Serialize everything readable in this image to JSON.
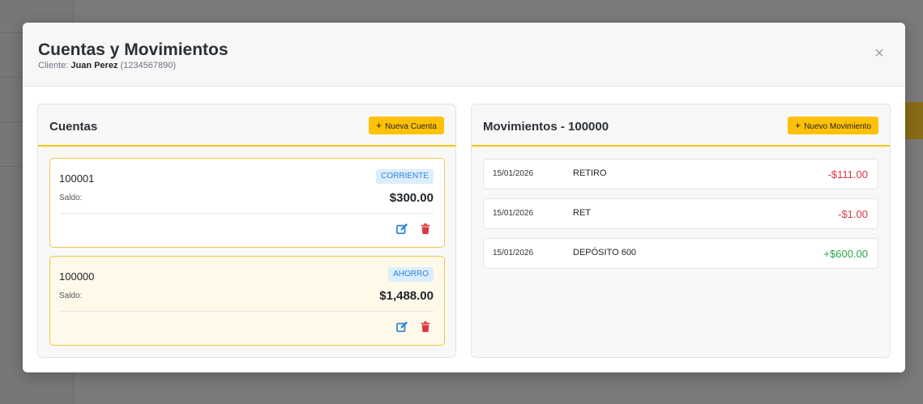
{
  "modal": {
    "title": "Cuentas y Movimientos",
    "client_label": "Cliente:",
    "client_name": "Juan Perez",
    "client_id": "(1234567890)",
    "close_glyph": "×"
  },
  "accounts_panel": {
    "title": "Cuentas",
    "new_button": "Nueva Cuenta",
    "accounts": [
      {
        "number": "100001",
        "type": "CORRIENTE",
        "saldo_label": "Saldo:",
        "saldo": "$300.00",
        "selected": false
      },
      {
        "number": "100000",
        "type": "AHORRO",
        "saldo_label": "Saldo:",
        "saldo": "$1,488.00",
        "selected": true
      }
    ]
  },
  "movements_panel": {
    "title": "Movimientos - 100000",
    "new_button": "Nuevo Movimiento",
    "movements": [
      {
        "date": "15/01/2026",
        "description": "RETIRO",
        "amount": "-$111.00",
        "kind": "debit"
      },
      {
        "date": "15/01/2026",
        "description": "RET",
        "amount": "-$1.00",
        "kind": "debit"
      },
      {
        "date": "15/01/2026",
        "description": "DEPÓSITO 600",
        "amount": "+$600.00",
        "kind": "credit"
      }
    ]
  },
  "colors": {
    "accent": "#ffc107",
    "debit": "#dc3545",
    "credit": "#28a745",
    "badge_bg": "#dbeefd",
    "badge_text": "#2f86d6"
  },
  "icons": {
    "edit": "edit-icon",
    "delete": "trash-icon",
    "close": "close-icon",
    "add": "plus-icon"
  }
}
